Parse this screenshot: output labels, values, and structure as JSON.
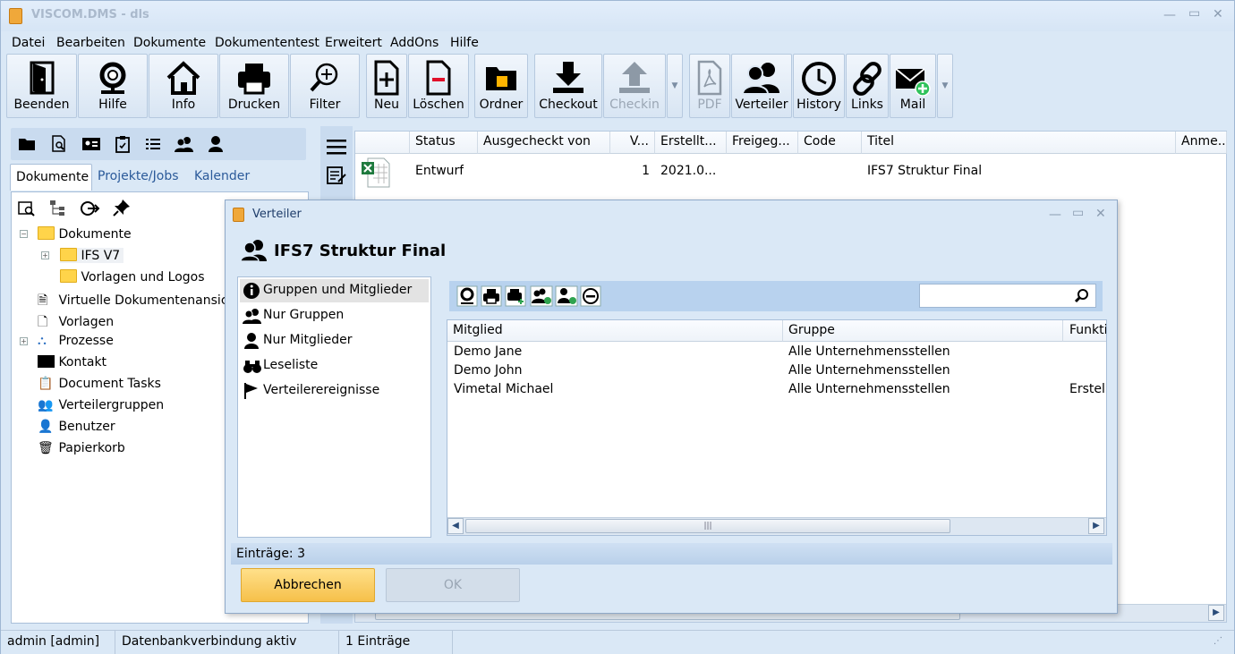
{
  "window": {
    "title": "VISCOM.DMS - dls"
  },
  "menu": [
    "Datei",
    "Bearbeiten",
    "Dokumente",
    "Dokumententest",
    "Erweitert",
    "AddOns",
    "Hilfe"
  ],
  "toolbar": {
    "beenden": "Beenden",
    "hilfe": "Hilfe",
    "info": "Info",
    "drucken": "Drucken",
    "filter": "Filter",
    "neu": "Neu",
    "loeschen": "Löschen",
    "ordner": "Ordner",
    "checkout": "Checkout",
    "checkin": "Checkin",
    "pdf": "PDF",
    "verteiler": "Verteiler",
    "history": "History",
    "links": "Links",
    "mail": "Mail"
  },
  "left": {
    "tabs": [
      "Dokumente",
      "Projekte/Jobs",
      "Kalender"
    ],
    "tree": {
      "root": "Dokumente",
      "ifs": "IFS V7",
      "vorlagen_logos": "Vorlagen und Logos",
      "virtuelle": "Virtuelle Dokumentenansicht",
      "vorlagen": "Vorlagen",
      "prozesse": "Prozesse",
      "kontakt": "Kontakt",
      "tasks": "Document Tasks",
      "verteilergruppen": "Verteilergruppen",
      "benutzer": "Benutzer",
      "papierkorb": "Papierkorb"
    }
  },
  "grid": {
    "columns": [
      "Status",
      "Ausgecheckt von",
      "V...",
      "Erstellt...",
      "Freigeg...",
      "Code",
      "Titel",
      "Anme..."
    ],
    "row": {
      "status": "Entwurf",
      "ausgecheckt": "",
      "version": "1",
      "erstellt": "2021.0...",
      "freigegeben": "",
      "code": "",
      "titel": "IFS7 Struktur Final"
    }
  },
  "statusbar": {
    "user": "admin [admin]",
    "db": "Datenbankverbindung aktiv",
    "count": "1 Einträge"
  },
  "dialog": {
    "title": "Verteiler",
    "heading": "IFS7 Struktur Final",
    "nav": [
      "Gruppen und Mitglieder",
      "Nur Gruppen",
      "Nur Mitglieder",
      "Leseliste",
      "Verteilerereignisse"
    ],
    "search_placeholder": "",
    "columns": [
      "Mitglied",
      "Gruppe",
      "Funktion"
    ],
    "rows": [
      {
        "mitglied": "Demo Jane",
        "gruppe": "Alle Unternehmensstellen",
        "funktion": ""
      },
      {
        "mitglied": "Demo John",
        "gruppe": "Alle Unternehmensstellen",
        "funktion": ""
      },
      {
        "mitglied": "Vimetal Michael",
        "gruppe": "Alle Unternehmensstellen",
        "funktion": "Erstel"
      }
    ],
    "status": "Einträge: 3",
    "cancel": "Abbrechen",
    "ok": "OK"
  }
}
